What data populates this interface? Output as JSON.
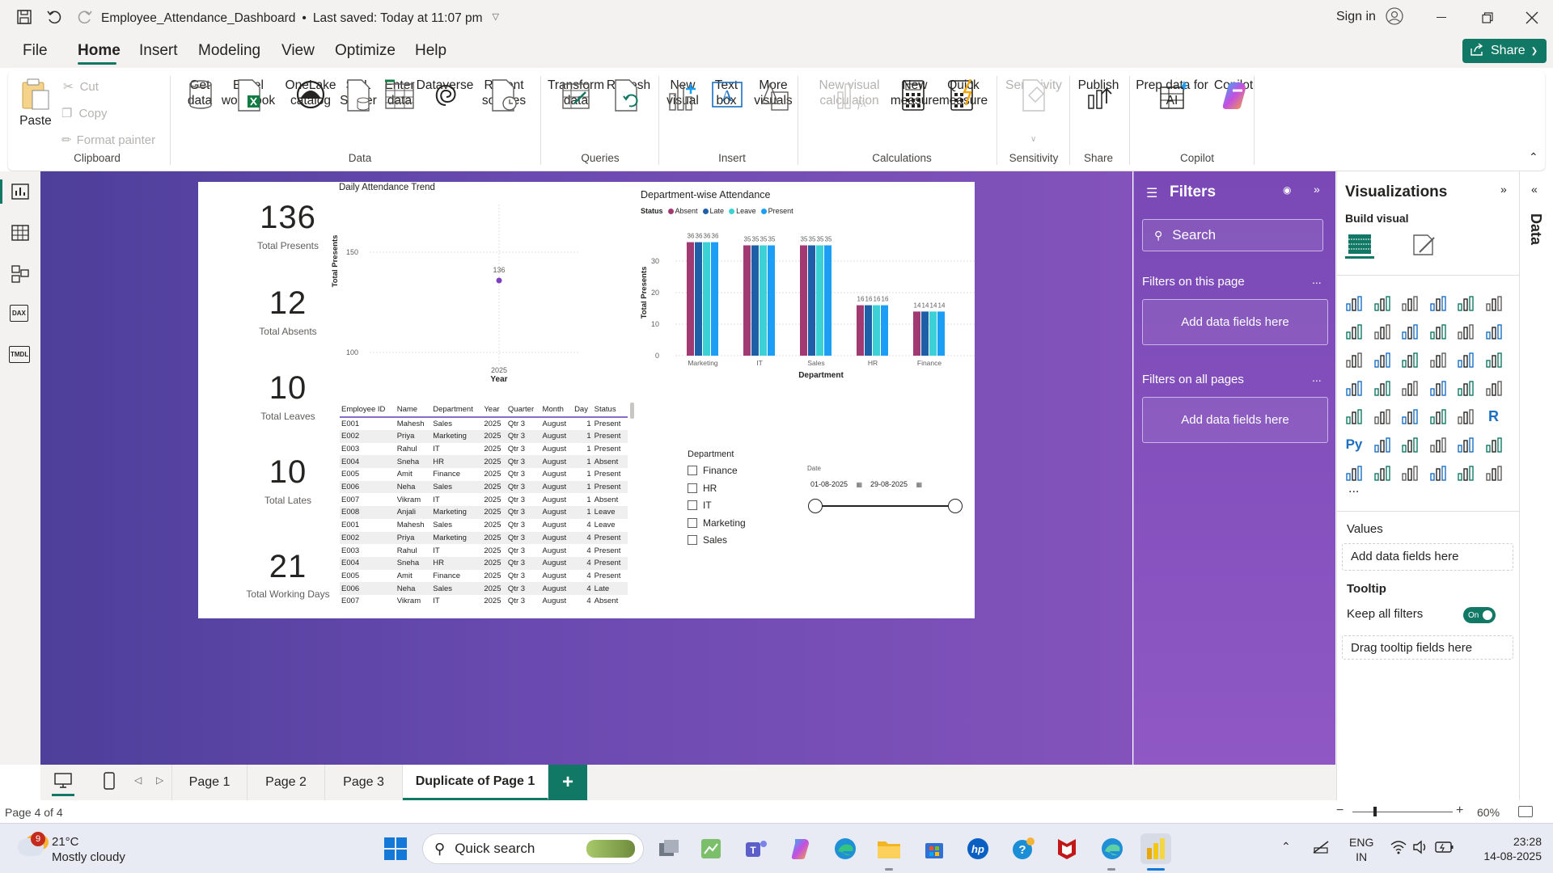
{
  "titlebar": {
    "file_name": "Employee_Attendance_Dashboard",
    "separator": "•",
    "saved": "Last saved: Today at 11:07 pm",
    "sign_in": "Sign in"
  },
  "menu": [
    "File",
    "Home",
    "Insert",
    "Modeling",
    "View",
    "Optimize",
    "Help"
  ],
  "share": "Share",
  "ribbon": {
    "paste": "Paste",
    "cut": "Cut",
    "copy": "Copy",
    "format_painter": "Format painter",
    "clipboard": "Clipboard",
    "get_data": "Get\ndata",
    "excel": "Excel\nworkbook",
    "onelake": "OneLake\ncatalog",
    "sql": "SQL\nServer",
    "enter": "Enter\ndata",
    "dataverse": "Dataverse",
    "recent": "Recent\nsources",
    "data": "Data",
    "transform": "Transform\ndata",
    "refresh": "Refresh",
    "queries": "Queries",
    "new_visual": "New\nvisual",
    "text_box": "Text\nbox",
    "more_visuals": "More\nvisuals",
    "insert": "Insert",
    "new_visual_calc": "New visual\ncalculation",
    "new_measure": "New\nmeasure",
    "quick_measure": "Quick\nmeasure",
    "calculations": "Calculations",
    "sensitivity": "Sensitivity",
    "sensitivity_grp": "Sensitivity",
    "publish": "Publish",
    "share_grp": "Share",
    "prep": "Prep data for\nAI",
    "copilot": "Copilot",
    "copilot_grp": "Copilot"
  },
  "cards": [
    {
      "value": "136",
      "label": "Total Presents"
    },
    {
      "value": "12",
      "label": "Total Absents"
    },
    {
      "value": "10",
      "label": "Total Leaves"
    },
    {
      "value": "10",
      "label": "Total Lates"
    },
    {
      "value": "21",
      "label": "Total Working Days"
    }
  ],
  "trend": {
    "title": "Daily Attendance Trend",
    "ylabel": "Total Presents",
    "xlabel": "Year",
    "tick_150": "150",
    "tick_100": "100",
    "point_label": "136",
    "x_tick": "2025"
  },
  "table": {
    "headers": [
      "Employee ID",
      "Name",
      "Department",
      "Year",
      "Quarter",
      "Month",
      "Day",
      "Status"
    ],
    "rows": [
      [
        "E001",
        "Mahesh",
        "Sales",
        "2025",
        "Qtr 3",
        "August",
        "1",
        "Present"
      ],
      [
        "E002",
        "Priya",
        "Marketing",
        "2025",
        "Qtr 3",
        "August",
        "1",
        "Present"
      ],
      [
        "E003",
        "Rahul",
        "IT",
        "2025",
        "Qtr 3",
        "August",
        "1",
        "Present"
      ],
      [
        "E004",
        "Sneha",
        "HR",
        "2025",
        "Qtr 3",
        "August",
        "1",
        "Absent"
      ],
      [
        "E005",
        "Amit",
        "Finance",
        "2025",
        "Qtr 3",
        "August",
        "1",
        "Present"
      ],
      [
        "E006",
        "Neha",
        "Sales",
        "2025",
        "Qtr 3",
        "August",
        "1",
        "Present"
      ],
      [
        "E007",
        "Vikram",
        "IT",
        "2025",
        "Qtr 3",
        "August",
        "1",
        "Absent"
      ],
      [
        "E008",
        "Anjali",
        "Marketing",
        "2025",
        "Qtr 3",
        "August",
        "1",
        "Leave"
      ],
      [
        "E001",
        "Mahesh",
        "Sales",
        "2025",
        "Qtr 3",
        "August",
        "4",
        "Leave"
      ],
      [
        "E002",
        "Priya",
        "Marketing",
        "2025",
        "Qtr 3",
        "August",
        "4",
        "Present"
      ],
      [
        "E003",
        "Rahul",
        "IT",
        "2025",
        "Qtr 3",
        "August",
        "4",
        "Present"
      ],
      [
        "E004",
        "Sneha",
        "HR",
        "2025",
        "Qtr 3",
        "August",
        "4",
        "Present"
      ],
      [
        "E005",
        "Amit",
        "Finance",
        "2025",
        "Qtr 3",
        "August",
        "4",
        "Present"
      ],
      [
        "E006",
        "Neha",
        "Sales",
        "2025",
        "Qtr 3",
        "August",
        "4",
        "Late"
      ],
      [
        "E007",
        "Vikram",
        "IT",
        "2025",
        "Qtr 3",
        "August",
        "4",
        "Absent"
      ]
    ]
  },
  "chart_data": {
    "type": "bar",
    "title": "Department-wise Attendance",
    "legend_title": "Status",
    "xlabel": "Department",
    "ylabel": "Total Presents",
    "categories": [
      "Marketing",
      "IT",
      "Sales",
      "HR",
      "Finance"
    ],
    "series": [
      {
        "name": "Absent",
        "color": "#a13a73",
        "values": [
          36,
          35,
          35,
          16,
          14
        ]
      },
      {
        "name": "Late",
        "color": "#1f5fa8",
        "values": [
          36,
          35,
          35,
          16,
          14
        ]
      },
      {
        "name": "Leave",
        "color": "#3cd1d4",
        "values": [
          36,
          35,
          35,
          16,
          14
        ]
      },
      {
        "name": "Present",
        "color": "#1c9ef5",
        "values": [
          36,
          35,
          35,
          16,
          14
        ]
      }
    ],
    "ylim": [
      0,
      40
    ],
    "y_ticks": [
      0,
      10,
      20,
      30
    ],
    "legend_position": "top-left",
    "grid": true
  },
  "dept_slicer": {
    "title": "Department",
    "items": [
      "Finance",
      "HR",
      "IT",
      "Marketing",
      "Sales"
    ]
  },
  "date_slicer": {
    "title": "Date",
    "start": "01-08-2025",
    "end": "29-08-2025"
  },
  "filters": {
    "title": "Filters",
    "search": "Search",
    "on_page": "Filters on this page",
    "on_all": "Filters on all pages",
    "add": "Add data fields here",
    "more": "..."
  },
  "viz": {
    "title": "Visualizations",
    "build": "Build visual",
    "values": "Values",
    "values_add": "Add data fields here",
    "tooltip": "Tooltip",
    "keep_filters": "Keep all filters",
    "toggle": "On",
    "drag": "Drag tooltip fields here",
    "more": "...",
    "r_icon": "R",
    "py_icon": "Py"
  },
  "data_pane": "Data",
  "tabs": [
    "Page 1",
    "Page 2",
    "Page 3",
    "Duplicate of Page 1"
  ],
  "status": {
    "page": "Page 4 of 4",
    "zoom": "60%"
  },
  "taskbar": {
    "weather_badge": "9",
    "temp": "21°C",
    "weather": "Mostly cloudy",
    "search": "Quick search",
    "lang1": "ENG",
    "lang2": "IN",
    "time": "23:28",
    "date": "14-08-2025"
  },
  "colors": {
    "accent": "#117865",
    "brand": "#f2c811",
    "canvas_left": "#4d3f9a",
    "canvas_right": "#8353bb"
  }
}
